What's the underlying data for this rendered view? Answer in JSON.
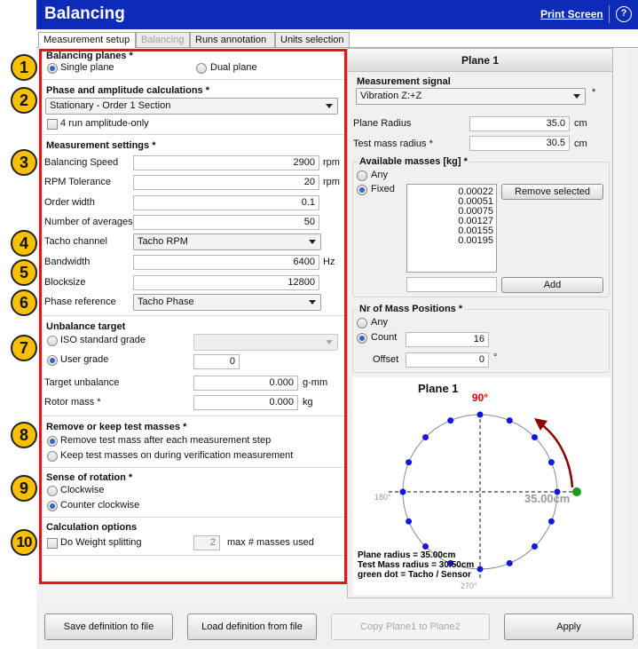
{
  "header": {
    "title": "Balancing",
    "print_screen": "Print Screen",
    "help_icon": "?"
  },
  "tabs": [
    {
      "label": "Measurement setup",
      "state": "active"
    },
    {
      "label": "Balancing",
      "state": "disabled"
    },
    {
      "label": "Runs annotation",
      "state": "normal"
    },
    {
      "label": "Units selection",
      "state": "normal"
    }
  ],
  "colors": {
    "header": "#0d2bb8",
    "highlight_border": "#e4141b",
    "badge": "#f8c000",
    "mass_dot": "#1515e0",
    "angle_90": "#e00000",
    "rotation_arrow": "#8b0000",
    "tacho_dot": "#1a9a1a"
  },
  "badges": [
    "1",
    "2",
    "3",
    "4",
    "5",
    "6",
    "7",
    "8",
    "9",
    "10"
  ],
  "balancing_planes": {
    "title": "Balancing planes *",
    "single": "Single plane",
    "dual": "Dual plane",
    "selected": "Single plane"
  },
  "phase_amp": {
    "title": "Phase and amplitude calculations *",
    "selected": "Stationary - Order 1 Section",
    "amp_only": "4 run amplitude-only"
  },
  "measurement_settings": {
    "title": "Measurement settings *",
    "balancing_speed": {
      "label": "Balancing Speed",
      "value": "2900",
      "unit": "rpm"
    },
    "rpm_tolerance": {
      "label": "RPM Tolerance",
      "value": "20",
      "unit": "rpm"
    },
    "order_width": {
      "label": "Order width",
      "value": "0.1"
    },
    "num_averages": {
      "label": "Number of averages",
      "value": "50"
    },
    "tacho_channel": {
      "label": "Tacho channel",
      "value": "Tacho RPM"
    },
    "bandwidth": {
      "label": "Bandwidth",
      "value": "6400",
      "unit": "Hz"
    },
    "blocksize": {
      "label": "Blocksize",
      "value": "12800"
    },
    "phase_reference": {
      "label": "Phase reference",
      "value": "Tacho Phase"
    }
  },
  "unbalance_target": {
    "title": "Unbalance target",
    "iso": "ISO standard grade",
    "user": "User grade",
    "user_value": "0",
    "target_label": "Target unbalance",
    "target_value": "0.000",
    "target_unit": "g-mm",
    "rotor_label": "Rotor mass *",
    "rotor_value": "0.000",
    "rotor_unit": "kg"
  },
  "test_masses": {
    "title": "Remove or keep test masses *",
    "remove": "Remove test mass after each measurement step",
    "keep": "Keep test masses on during verification measurement"
  },
  "rotation": {
    "title": "Sense of rotation *",
    "cw": "Clockwise",
    "ccw": "Counter clockwise"
  },
  "calc_options": {
    "title": "Calculation options",
    "weight_split": "Do Weight splitting",
    "max_value": "2",
    "max_label": "max # masses used"
  },
  "plane": {
    "header": "Plane 1",
    "signal_title": "Measurement signal",
    "signal_value": "Vibration Z:+Z",
    "signal_star": "*",
    "radius_label": "Plane Radius",
    "radius_value": "35.0",
    "radius_unit": "cm",
    "test_radius_label": "Test mass radius *",
    "test_radius_value": "30.5",
    "test_radius_unit": "cm",
    "masses_title": "Available masses [kg] *",
    "any": "Any",
    "fixed": "Fixed",
    "masses": [
      "0.00022",
      "0.00051",
      "0.00075",
      "0.00127",
      "0.00155",
      "0.00195"
    ],
    "remove_selected": "Remove selected",
    "add": "Add",
    "positions_title": "Nr of Mass Positions *",
    "pos_any": "Any",
    "count_label": "Count",
    "count_value": "16",
    "offset_label": "Offset",
    "offset_value": "0",
    "offset_unit": "°"
  },
  "plot": {
    "title": "Plane 1",
    "angle_top": "90°",
    "angle_left": "180°",
    "angle_bottom": "270°",
    "radius_text": "35.00cm",
    "mass_positions": 16,
    "legend": [
      "Plane radius = 35.00cm",
      "Test Mass radius = 30.50cm",
      "green dot = Tacho / Sensor"
    ]
  },
  "buttons": {
    "save": "Save definition to file",
    "load": "Load definition from file",
    "copy": "Copy Plane1 to Plane2",
    "apply": "Apply"
  }
}
